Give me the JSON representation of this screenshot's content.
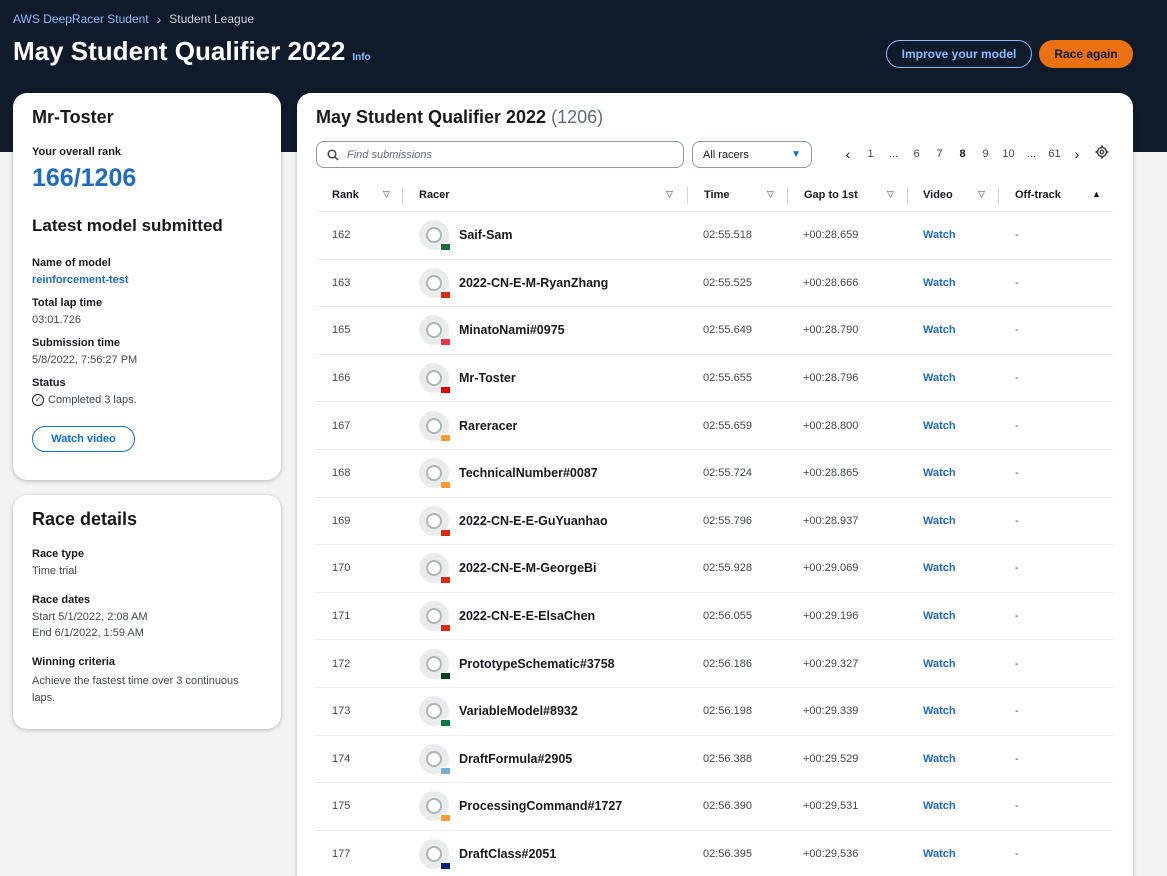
{
  "header": {
    "breadcrumb": [
      "AWS DeepRacer Student",
      "Student League"
    ],
    "title": "May Student Qualifier 2022",
    "info_label": "Info",
    "improve_button": "Improve your model",
    "race_button": "Race again"
  },
  "user_card": {
    "username": "Mr-Toster",
    "rank_label": "Your overall rank",
    "rank_value": "166/1206",
    "latest_heading": "Latest model submitted",
    "model_name_label": "Name of model",
    "model_name": "reinforcement-test",
    "lap_time_label": "Total lap time",
    "lap_time": "03:01.726",
    "submission_time_label": "Submission time",
    "submission_time": "5/8/2022, 7:56:27 PM",
    "status_label": "Status",
    "status": "Completed 3 laps.",
    "watch_button": "Watch video"
  },
  "race_card": {
    "heading": "Race details",
    "type_label": "Race type",
    "type": "Time trial",
    "dates_label": "Race dates",
    "start": "Start 5/1/2022, 2:08 AM",
    "end": "End 6/1/2022, 1:59 AM",
    "criteria_label": "Winning criteria",
    "criteria": "Achieve the fastest time over 3 continuous laps."
  },
  "leaderboard": {
    "title": "May Student Qualifier 2022",
    "count": "(1206)",
    "search_placeholder": "Find submissions",
    "filter_value": "All racers",
    "pagination": [
      "1",
      "...",
      "6",
      "7",
      "8",
      "9",
      "10",
      "...",
      "61"
    ],
    "current_page": "8",
    "columns": {
      "rank": "Rank",
      "racer": "Racer",
      "time": "Time",
      "gap": "Gap to 1st",
      "video": "Video",
      "offtrack": "Off-track"
    },
    "rows": [
      {
        "rank": "162",
        "name": "Saif-Sam",
        "time": "02:55.518",
        "gap": "+00:28.659",
        "video": "Watch",
        "offtrack": "-",
        "flag": "#1b6e3a"
      },
      {
        "rank": "163",
        "name": "2022-CN-E-M-RyanZhang",
        "time": "02:55.525",
        "gap": "+00:28.666",
        "video": "Watch",
        "offtrack": "-",
        "flag": "#de2910"
      },
      {
        "rank": "165",
        "name": "MinatoNami#0975",
        "time": "02:55.649",
        "gap": "+00:28.790",
        "video": "Watch",
        "offtrack": "-",
        "flag": "#ef3340"
      },
      {
        "rank": "166",
        "name": "Mr-Toster",
        "time": "02:55.655",
        "gap": "+00:28.796",
        "video": "Watch",
        "offtrack": "-",
        "flag": "#dd0000"
      },
      {
        "rank": "167",
        "name": "Rareracer",
        "time": "02:55.659",
        "gap": "+00:28.800",
        "video": "Watch",
        "offtrack": "-",
        "flag": "#ff9933"
      },
      {
        "rank": "168",
        "name": "TechnicalNumber#0087",
        "time": "02:55.724",
        "gap": "+00:28.865",
        "video": "Watch",
        "offtrack": "-",
        "flag": "#ff9933"
      },
      {
        "rank": "169",
        "name": "2022-CN-E-E-GuYuanhao",
        "time": "02:55.796",
        "gap": "+00:28.937",
        "video": "Watch",
        "offtrack": "-",
        "flag": "#de2910"
      },
      {
        "rank": "170",
        "name": "2022-CN-E-M-GeorgeBi",
        "time": "02:55.928",
        "gap": "+00:29.069",
        "video": "Watch",
        "offtrack": "-",
        "flag": "#de2910"
      },
      {
        "rank": "171",
        "name": "2022-CN-E-E-ElsaChen",
        "time": "02:56.055",
        "gap": "+00:29.196",
        "video": "Watch",
        "offtrack": "-",
        "flag": "#de2910"
      },
      {
        "rank": "172",
        "name": "PrototypeSchematic#3758",
        "time": "02:56.186",
        "gap": "+00:29.327",
        "video": "Watch",
        "offtrack": "-",
        "flag": "#01411c"
      },
      {
        "rank": "173",
        "name": "VariableModel#8932",
        "time": "02:56.198",
        "gap": "+00:29.339",
        "video": "Watch",
        "offtrack": "-",
        "flag": "#007a3d"
      },
      {
        "rank": "174",
        "name": "DraftFormula#2905",
        "time": "02:56.388",
        "gap": "+00:29.529",
        "video": "Watch",
        "offtrack": "-",
        "flag": "#74acdf"
      },
      {
        "rank": "175",
        "name": "ProcessingCommand#1727",
        "time": "02:56.390",
        "gap": "+00:29.531",
        "video": "Watch",
        "offtrack": "-",
        "flag": "#ff9933"
      },
      {
        "rank": "177",
        "name": "DraftClass#2051",
        "time": "02:56.395",
        "gap": "+00:29.536",
        "video": "Watch",
        "offtrack": "-",
        "flag": "#00247d"
      }
    ]
  },
  "colors": {
    "hero": "#0f1b2a",
    "accent_orange": "#ec7211",
    "link_blue": "#1e6bc2"
  }
}
